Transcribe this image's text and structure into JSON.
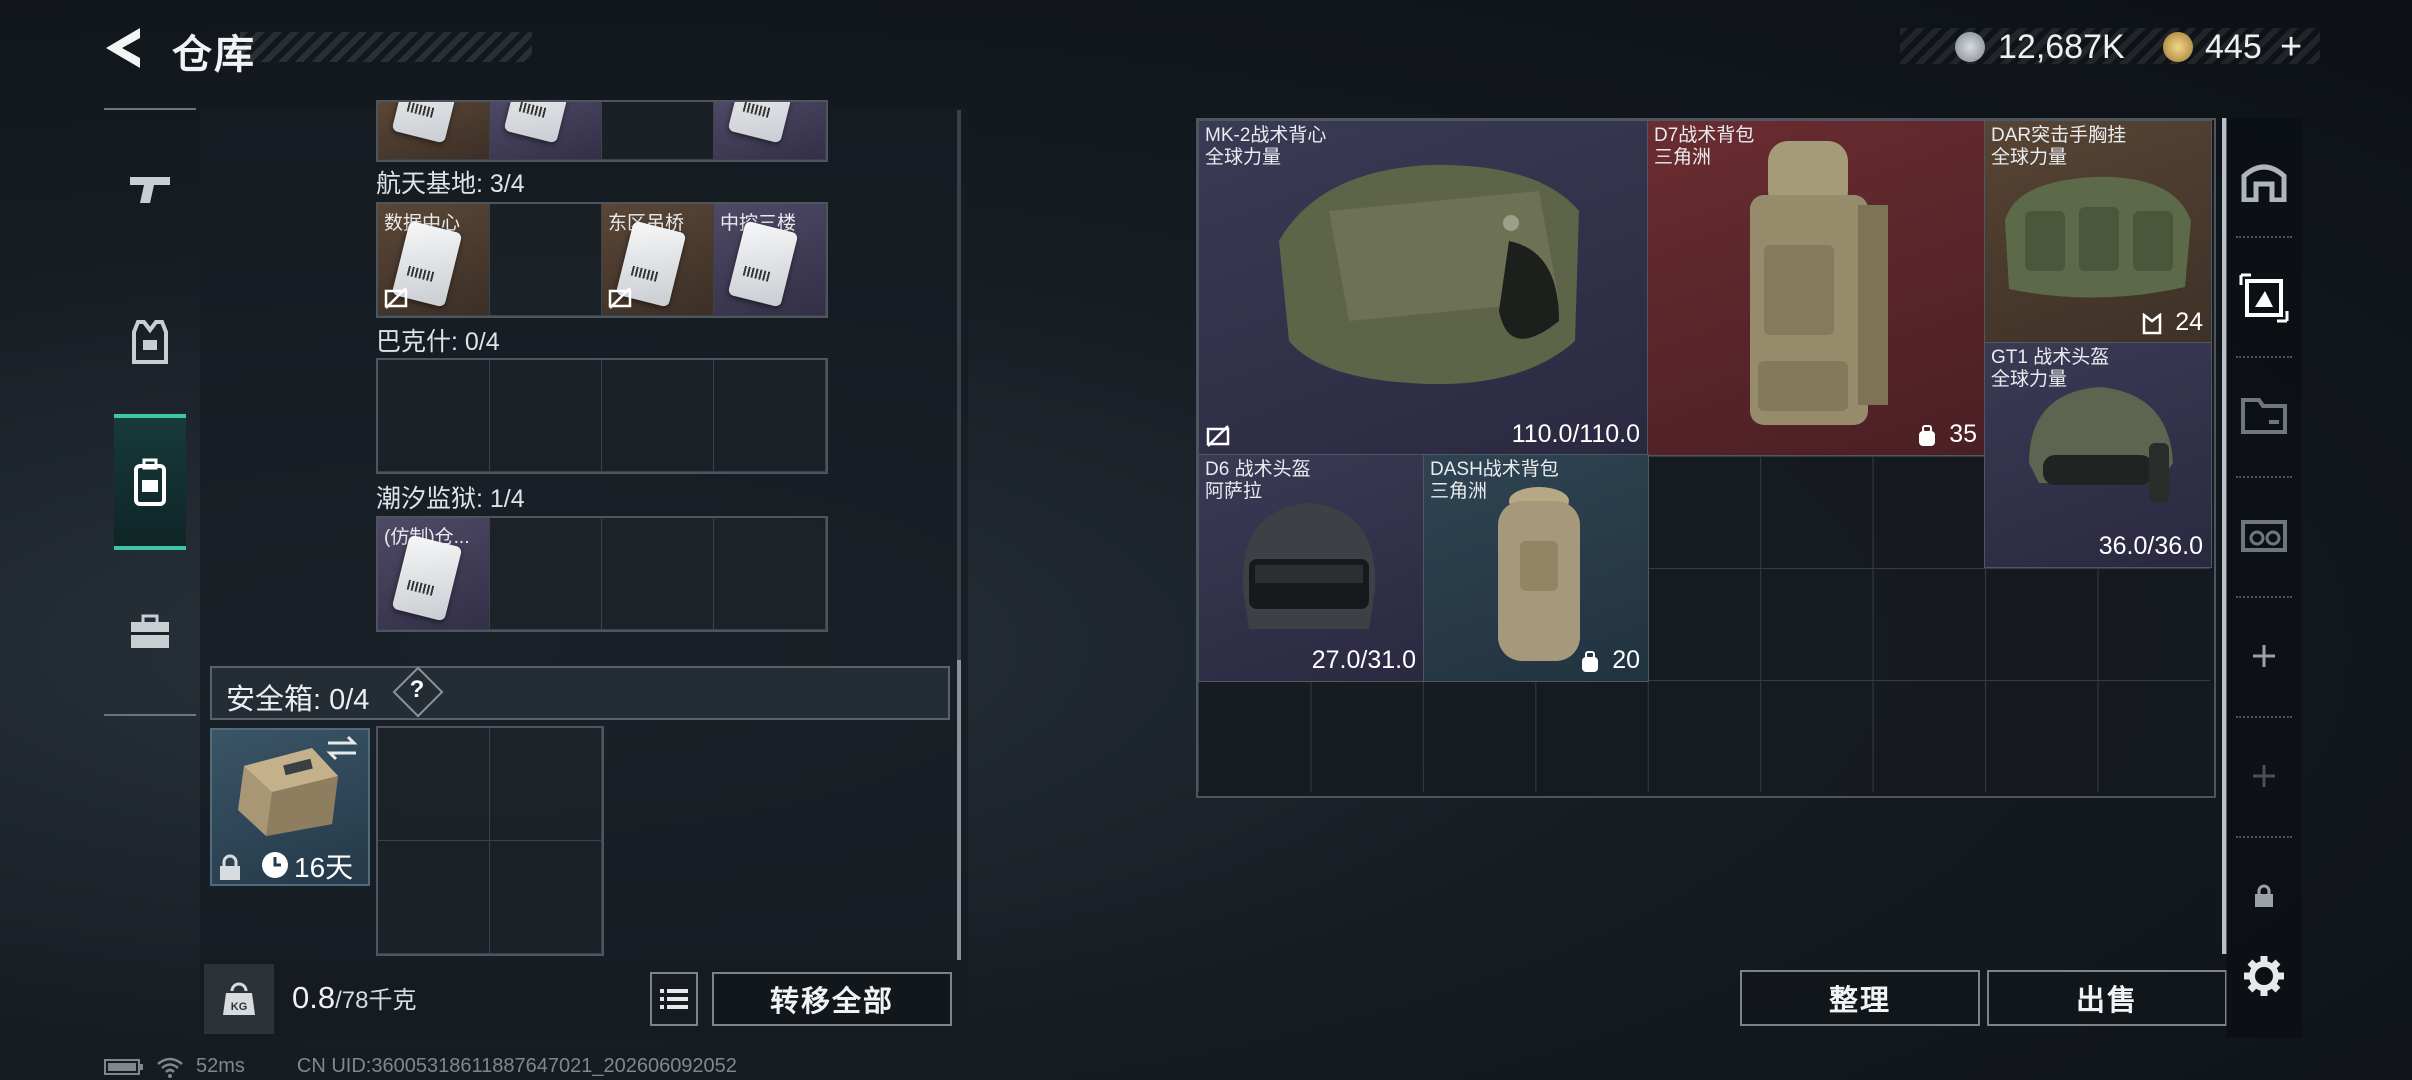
{
  "header": {
    "title": "仓库",
    "silver": "12,687K",
    "gold": "445",
    "gold_add": "+"
  },
  "nav_left": [
    {
      "name": "weapons-icon"
    },
    {
      "name": "armor-icon"
    },
    {
      "name": "backpack-icon"
    },
    {
      "name": "toolbox-icon"
    }
  ],
  "sections": [
    {
      "label": "航天基地: 3/4",
      "cells": [
        "数据中心",
        "",
        "东区吊桥",
        "中控三楼"
      ]
    },
    {
      "label": "巴克什: 0/4",
      "cells": [
        "",
        "",
        "",
        ""
      ]
    },
    {
      "label": "潮汐监狱: 1/4",
      "cells": [
        "(仿制)仓...",
        "",
        "",
        ""
      ]
    }
  ],
  "safebox": {
    "label": "安全箱: 0/4",
    "help": "?",
    "days": "16天"
  },
  "weight": {
    "current": "0.8",
    "max": "/78千克"
  },
  "buttons": {
    "transfer_all": "转移全部",
    "sort": "整理",
    "sell": "出售"
  },
  "stash_items": [
    {
      "name": "MK-2战术背心\n全球力量",
      "value": "110.0/110.0"
    },
    {
      "name": "D7战术背包\n三角洲",
      "value": "35"
    },
    {
      "name": "DAR突击手胸挂\n全球力量",
      "value": "24"
    },
    {
      "name": "GT1 战术头盔\n全球力量",
      "value": "36.0/36.0"
    },
    {
      "name": "D6 战术头盔\n阿萨拉",
      "value": "27.0/31.0"
    },
    {
      "name": "DASH战术背包\n三角洲",
      "value": "20"
    }
  ],
  "status": {
    "ping": "52ms",
    "uid": "CN UID:36005318611887647021_202606092052"
  },
  "colors": {
    "accent": "#3fc7a5",
    "epic": "#3b3a55",
    "legendary": "#6a2c31",
    "rare": "#574434",
    "blue": "#2f4352"
  }
}
